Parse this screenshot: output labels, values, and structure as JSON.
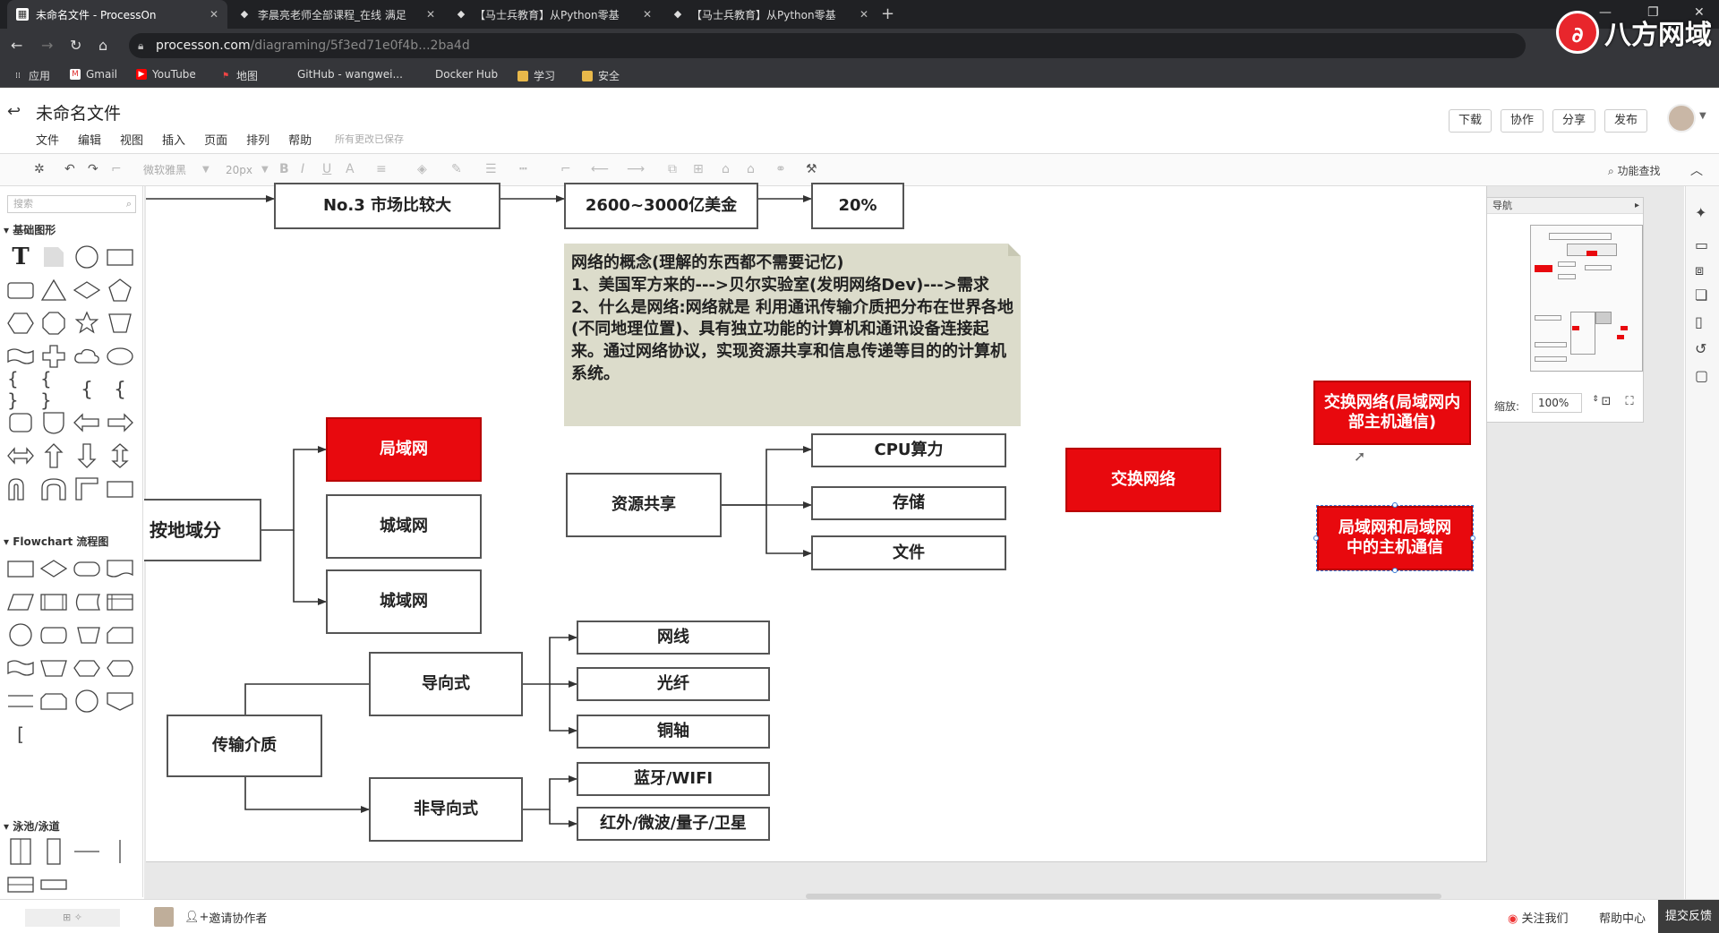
{
  "browser": {
    "tabs": [
      {
        "title": "未命名文件 - ProcessOn",
        "active": true
      },
      {
        "title": "李晨亮老师全部课程_在线 满足",
        "active": false
      },
      {
        "title": "【马士兵教育】从Python零基",
        "active": false
      },
      {
        "title": "【马士兵教育】从Python零基",
        "active": false
      }
    ],
    "url_host": "processon.com",
    "url_path": "/diagraming/5f3ed71e0f4b...2ba4d",
    "bookmarks": [
      "应用",
      "Gmail",
      "YouTube",
      "地图",
      "GitHub - wangwei...",
      "Docker Hub",
      "学习",
      "安全"
    ],
    "watermark": "八方网域"
  },
  "app": {
    "doc_title": "未命名文件",
    "menu": [
      "文件",
      "编辑",
      "视图",
      "插入",
      "页面",
      "排列",
      "帮助"
    ],
    "saved_hint": "所有更改已保存",
    "header_buttons": [
      "下载",
      "协作",
      "分享",
      "发布"
    ],
    "toolbar": {
      "font": "微软雅黑",
      "size": "20px",
      "find": "功能查找"
    }
  },
  "left_panel": {
    "search_placeholder": "搜索",
    "sections": [
      "基础图形",
      "Flowchart 流程图",
      "泳池/泳道"
    ]
  },
  "diagram": {
    "top_row": [
      "No.3 市场比较大",
      "2600~3000亿美金",
      "20%"
    ],
    "note": {
      "title": "网络的概念(理解的东西都不需要记忆)",
      "line1": "1、美国军方来的--->贝尔实验室(发明网络Dev)--->需求",
      "line2": "2、什么是网络:网络就是 利用通讯传输介质把分布在世界各地(不同地理位置)、具有独立功能的计算机和通讯设备连接起来。通过网络协议，实现资源共享和信息传递等目的的计算机系统。"
    },
    "by_region": "按地域分",
    "regions": [
      "局域网",
      "城域网",
      "城域网"
    ],
    "resource_share": "资源共享",
    "resources": [
      "CPU算力",
      "存储",
      "文件"
    ],
    "medium": "传输介质",
    "guided": "导向式",
    "guided_items": [
      "网线",
      "光纤",
      "铜轴"
    ],
    "unguided": "非导向式",
    "unguided_items": [
      "蓝牙/WIFI",
      "红外/微波/量子/卫星"
    ],
    "switch_network": "交换网络",
    "switch_network_desc": "交换网络(局域网内部主机通信)",
    "lan_to_lan": "局域网和局域网中的主机通信"
  },
  "navigator": {
    "title": "导航",
    "zoom_label": "缩放:",
    "zoom": "100%"
  },
  "bottom": {
    "invite": "邀请协作者",
    "follow": "关注我们",
    "help": "帮助中心",
    "feedback": "提交反馈"
  }
}
